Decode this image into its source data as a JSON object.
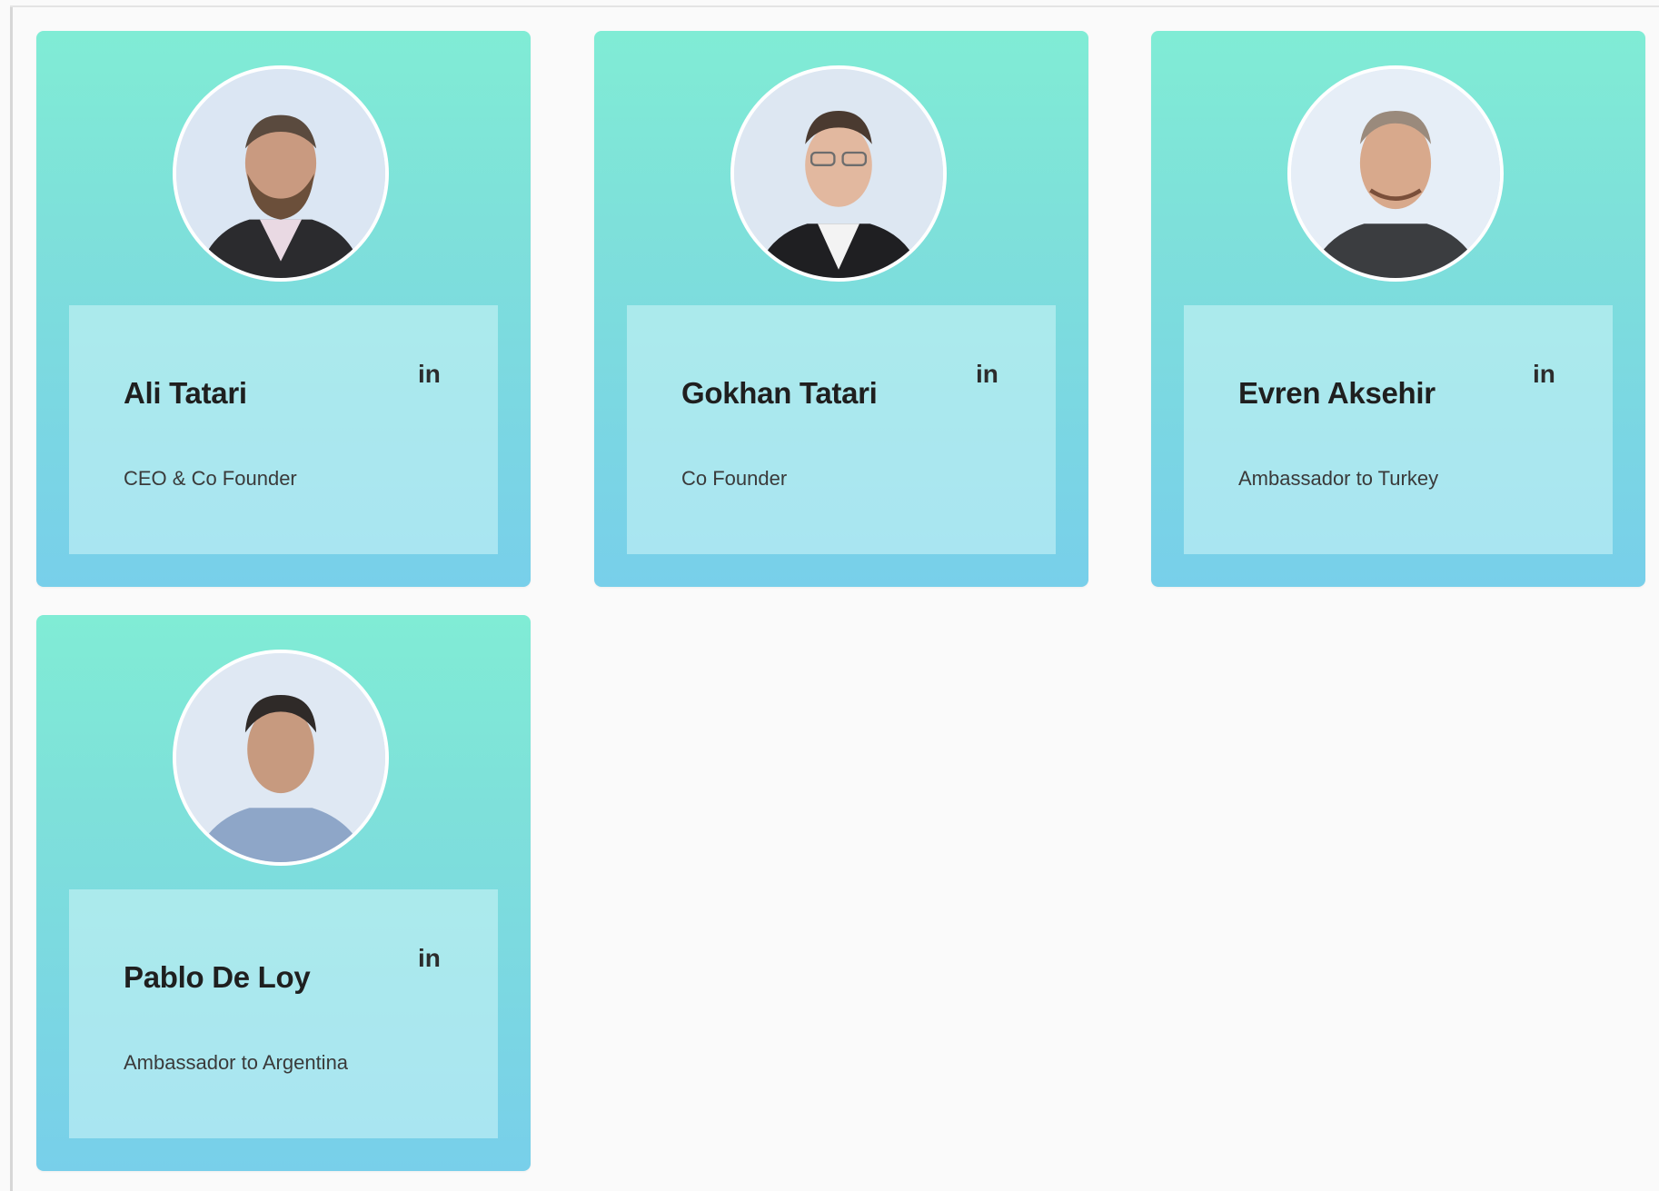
{
  "team": [
    {
      "name": "Ali Tatari",
      "role": "CEO & Co Founder",
      "linkedin_label": "in"
    },
    {
      "name": "Gokhan Tatari",
      "role": "Co Founder",
      "linkedin_label": "in"
    },
    {
      "name": "Evren Aksehir",
      "role": "Ambassador to Turkey",
      "linkedin_label": "in"
    },
    {
      "name": "Pablo De Loy",
      "role": "Ambassador to Argentina",
      "linkedin_label": "in"
    }
  ],
  "colors": {
    "card_gradient_top": "#80ecd5",
    "card_gradient_bottom": "#78cfea",
    "name_text": "#1f1f1f",
    "role_text": "#3a3a3a"
  }
}
